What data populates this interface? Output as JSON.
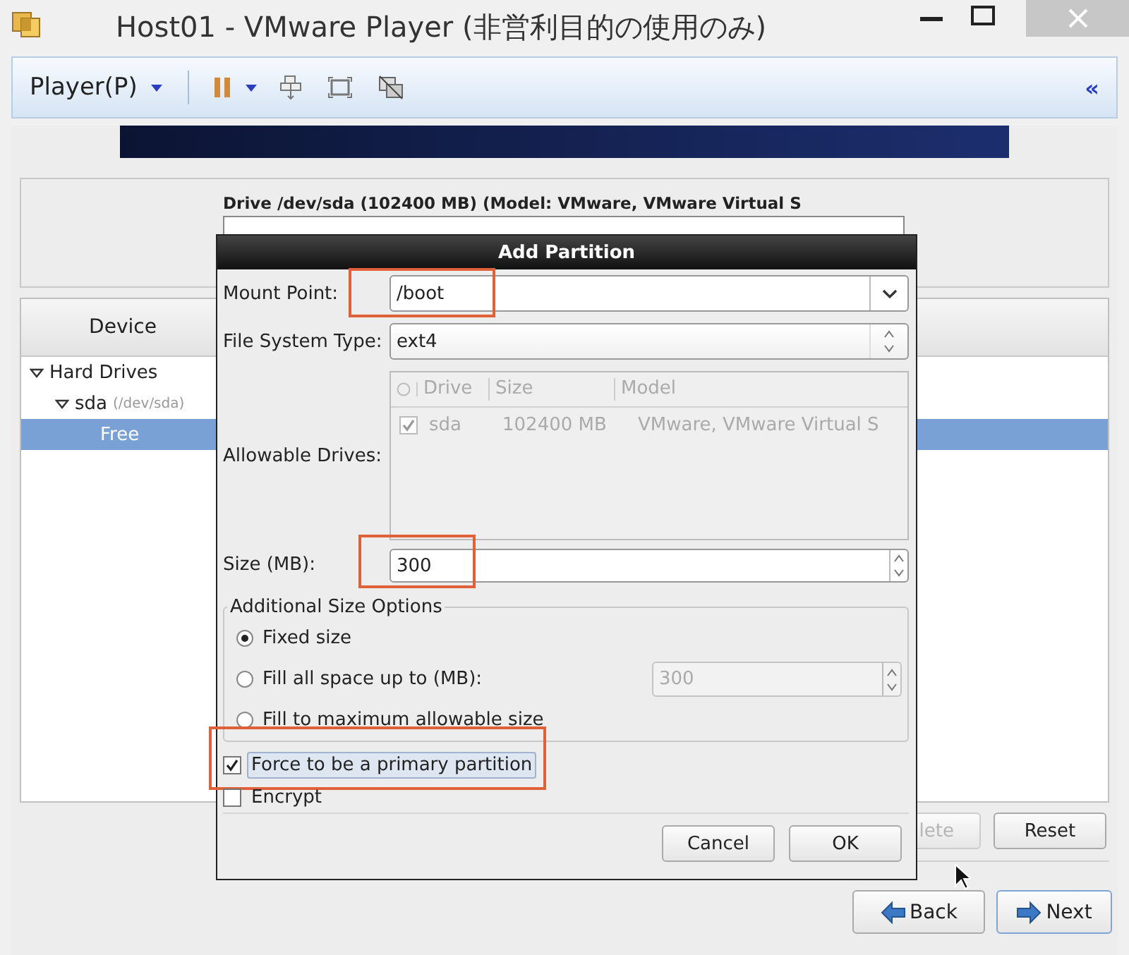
{
  "window": {
    "title": "Host01 - VMware Player (非営利目的の使用のみ)"
  },
  "toolbar": {
    "menu": "Player(P)",
    "collapse": "«"
  },
  "installer": {
    "drive_header": "Drive /dev/sda (102400 MB) (Model: VMware, VMware Virtual S",
    "device_column": "Device",
    "tree": [
      {
        "label": "Hard Drives",
        "expanded": true,
        "selected": false,
        "children": [
          {
            "label": "sda",
            "detail": "(/dev/sda)",
            "expanded": true,
            "selected": false,
            "children": [
              {
                "label": "Free",
                "selected": true
              }
            ]
          }
        ]
      }
    ],
    "buttons": [
      {
        "label": "lete",
        "disabled": true
      },
      {
        "label": "Reset",
        "disabled": false
      }
    ],
    "nav": [
      {
        "label": "Back",
        "kind": "back"
      },
      {
        "label": "Next",
        "kind": "next"
      }
    ]
  },
  "dialog": {
    "title": "Add Partition",
    "mount_point": {
      "label": "Mount Point:",
      "value": "/boot",
      "highlighted": true
    },
    "fs_type": {
      "label": "File System Type:",
      "value": "ext4"
    },
    "drives": {
      "label": "Allowable Drives:",
      "columns": [
        "Drive",
        "Size",
        "Model"
      ],
      "rows": [
        {
          "checked": true,
          "drive": "sda",
          "size": "102400 MB",
          "model": "VMware, VMware Virtual S"
        }
      ]
    },
    "size": {
      "label": "Size (MB):",
      "value": "300",
      "highlighted": true
    },
    "size_options": {
      "title": "Additional Size Options",
      "options": [
        {
          "label": "Fixed size",
          "selected": true
        },
        {
          "label": "Fill all space up to (MB):",
          "selected": false,
          "value": "300"
        },
        {
          "label": "Fill to maximum allowable size",
          "selected": false
        }
      ]
    },
    "checkboxes": [
      {
        "label": "Force to be a primary partition",
        "checked": true,
        "focused": true,
        "highlighted": true
      },
      {
        "label": "Encrypt",
        "checked": false,
        "focused": false,
        "highlighted": false
      }
    ],
    "buttons": [
      "Cancel",
      "OK"
    ]
  }
}
